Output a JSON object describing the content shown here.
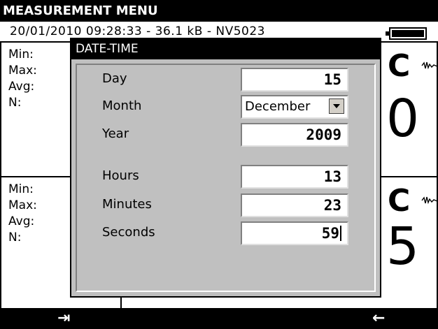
{
  "header": {
    "title": "MEASUREMENT MENU"
  },
  "status": {
    "datetime": "20/01/2010 09:28:33 - 36.1 kB  - NV5023"
  },
  "panels": [
    {
      "stats": [
        "Min:",
        "Max:",
        "Avg:",
        "N:"
      ],
      "unit": "C",
      "value": "0"
    },
    {
      "stats": [
        "Min:",
        "Max:",
        "Avg:",
        "N:"
      ],
      "unit": "C",
      "value": "5"
    }
  ],
  "dialog": {
    "title": "DATE-TIME",
    "fields": {
      "day": {
        "label": "Day",
        "value": "15"
      },
      "month": {
        "label": "Month",
        "value": "December"
      },
      "year": {
        "label": "Year",
        "value": "2009"
      },
      "hours": {
        "label": "Hours",
        "value": "13"
      },
      "minutes": {
        "label": "Minutes",
        "value": "23"
      },
      "seconds": {
        "label": "Seconds",
        "value": "59"
      }
    }
  },
  "softkeys": {
    "left": "⇥",
    "right": "←"
  },
  "icons": {
    "battery": "battery-icon",
    "wave": "wave-icon",
    "dropdown": "chevron-down-icon"
  }
}
